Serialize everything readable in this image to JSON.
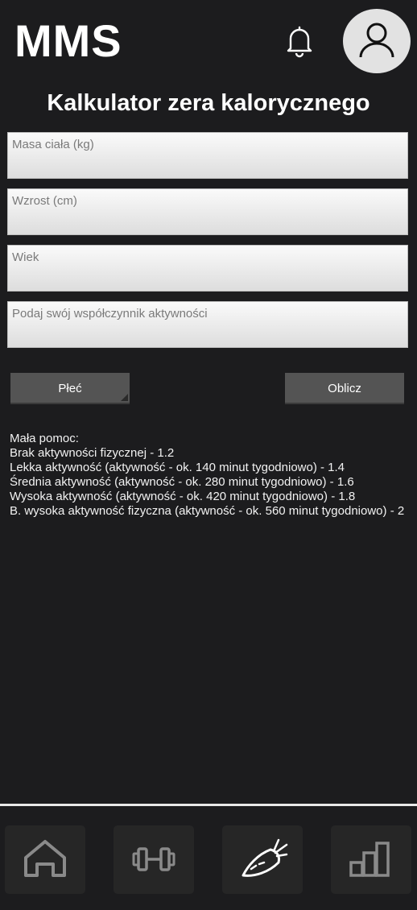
{
  "header": {
    "app_title": "MMS"
  },
  "page": {
    "title": "Kalkulator zera kalorycznego"
  },
  "form": {
    "fields": [
      {
        "placeholder": "Masa ciała (kg)",
        "value": ""
      },
      {
        "placeholder": "Wzrost (cm)",
        "value": ""
      },
      {
        "placeholder": "Wiek",
        "value": ""
      },
      {
        "placeholder": "Podaj swój współczynnik aktywności",
        "value": ""
      }
    ],
    "gender_button": "Płeć",
    "calculate_button": "Oblicz"
  },
  "help": {
    "title": "Mała pomoc:",
    "lines": [
      "Brak aktywności fizycznej - 1.2",
      "Lekka aktywność (aktywność - ok. 140 minut tygodniowo) - 1.4",
      "Średnia aktywność (aktywność - ok. 280 minut tygodniowo) - 1.6",
      "Wysoka aktywność (aktywność - ok. 420 minut tygodniowo) - 1.8",
      "B. wysoka aktywność fizyczna (aktywność - ok. 560 minut tygodniowo) - 2"
    ]
  },
  "nav": {
    "items": [
      {
        "icon": "home-icon"
      },
      {
        "icon": "dumbbell-icon"
      },
      {
        "icon": "carrot-icon"
      },
      {
        "icon": "bar-chart-icon"
      }
    ]
  },
  "colors": {
    "background": "#1c1c1e",
    "input_background": "#f2f2f2",
    "button_background": "#545454",
    "nav_tile": "#262626",
    "nav_icon": "#8a8a8a",
    "avatar_background": "#e2e2e2"
  }
}
